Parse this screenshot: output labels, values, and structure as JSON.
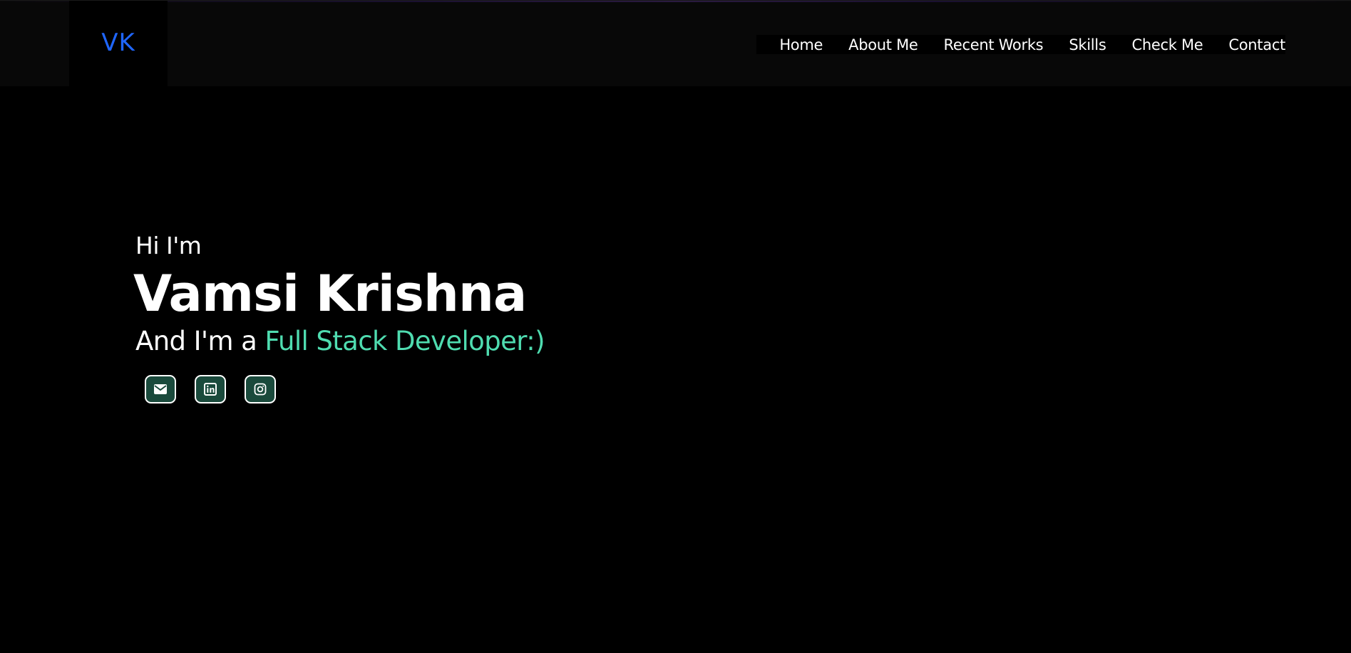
{
  "header": {
    "logo": "VK",
    "nav": [
      {
        "label": "Home"
      },
      {
        "label": "About Me"
      },
      {
        "label": "Recent Works"
      },
      {
        "label": "Skills"
      },
      {
        "label": "Check Me"
      },
      {
        "label": "Contact"
      }
    ]
  },
  "hero": {
    "greeting": "Hi I'm",
    "name": "Vamsi Krishna",
    "role_prefix": "And I'm a ",
    "role": "Full Stack Developer:)"
  },
  "social": [
    {
      "icon": "mail-icon"
    },
    {
      "icon": "linkedin-icon"
    },
    {
      "icon": "instagram-icon"
    }
  ],
  "colors": {
    "background": "#000000",
    "navbar": "#080808",
    "logo": "#1f66ff",
    "accent": "#4fdcb0",
    "social_button": "#1a4a3c"
  }
}
